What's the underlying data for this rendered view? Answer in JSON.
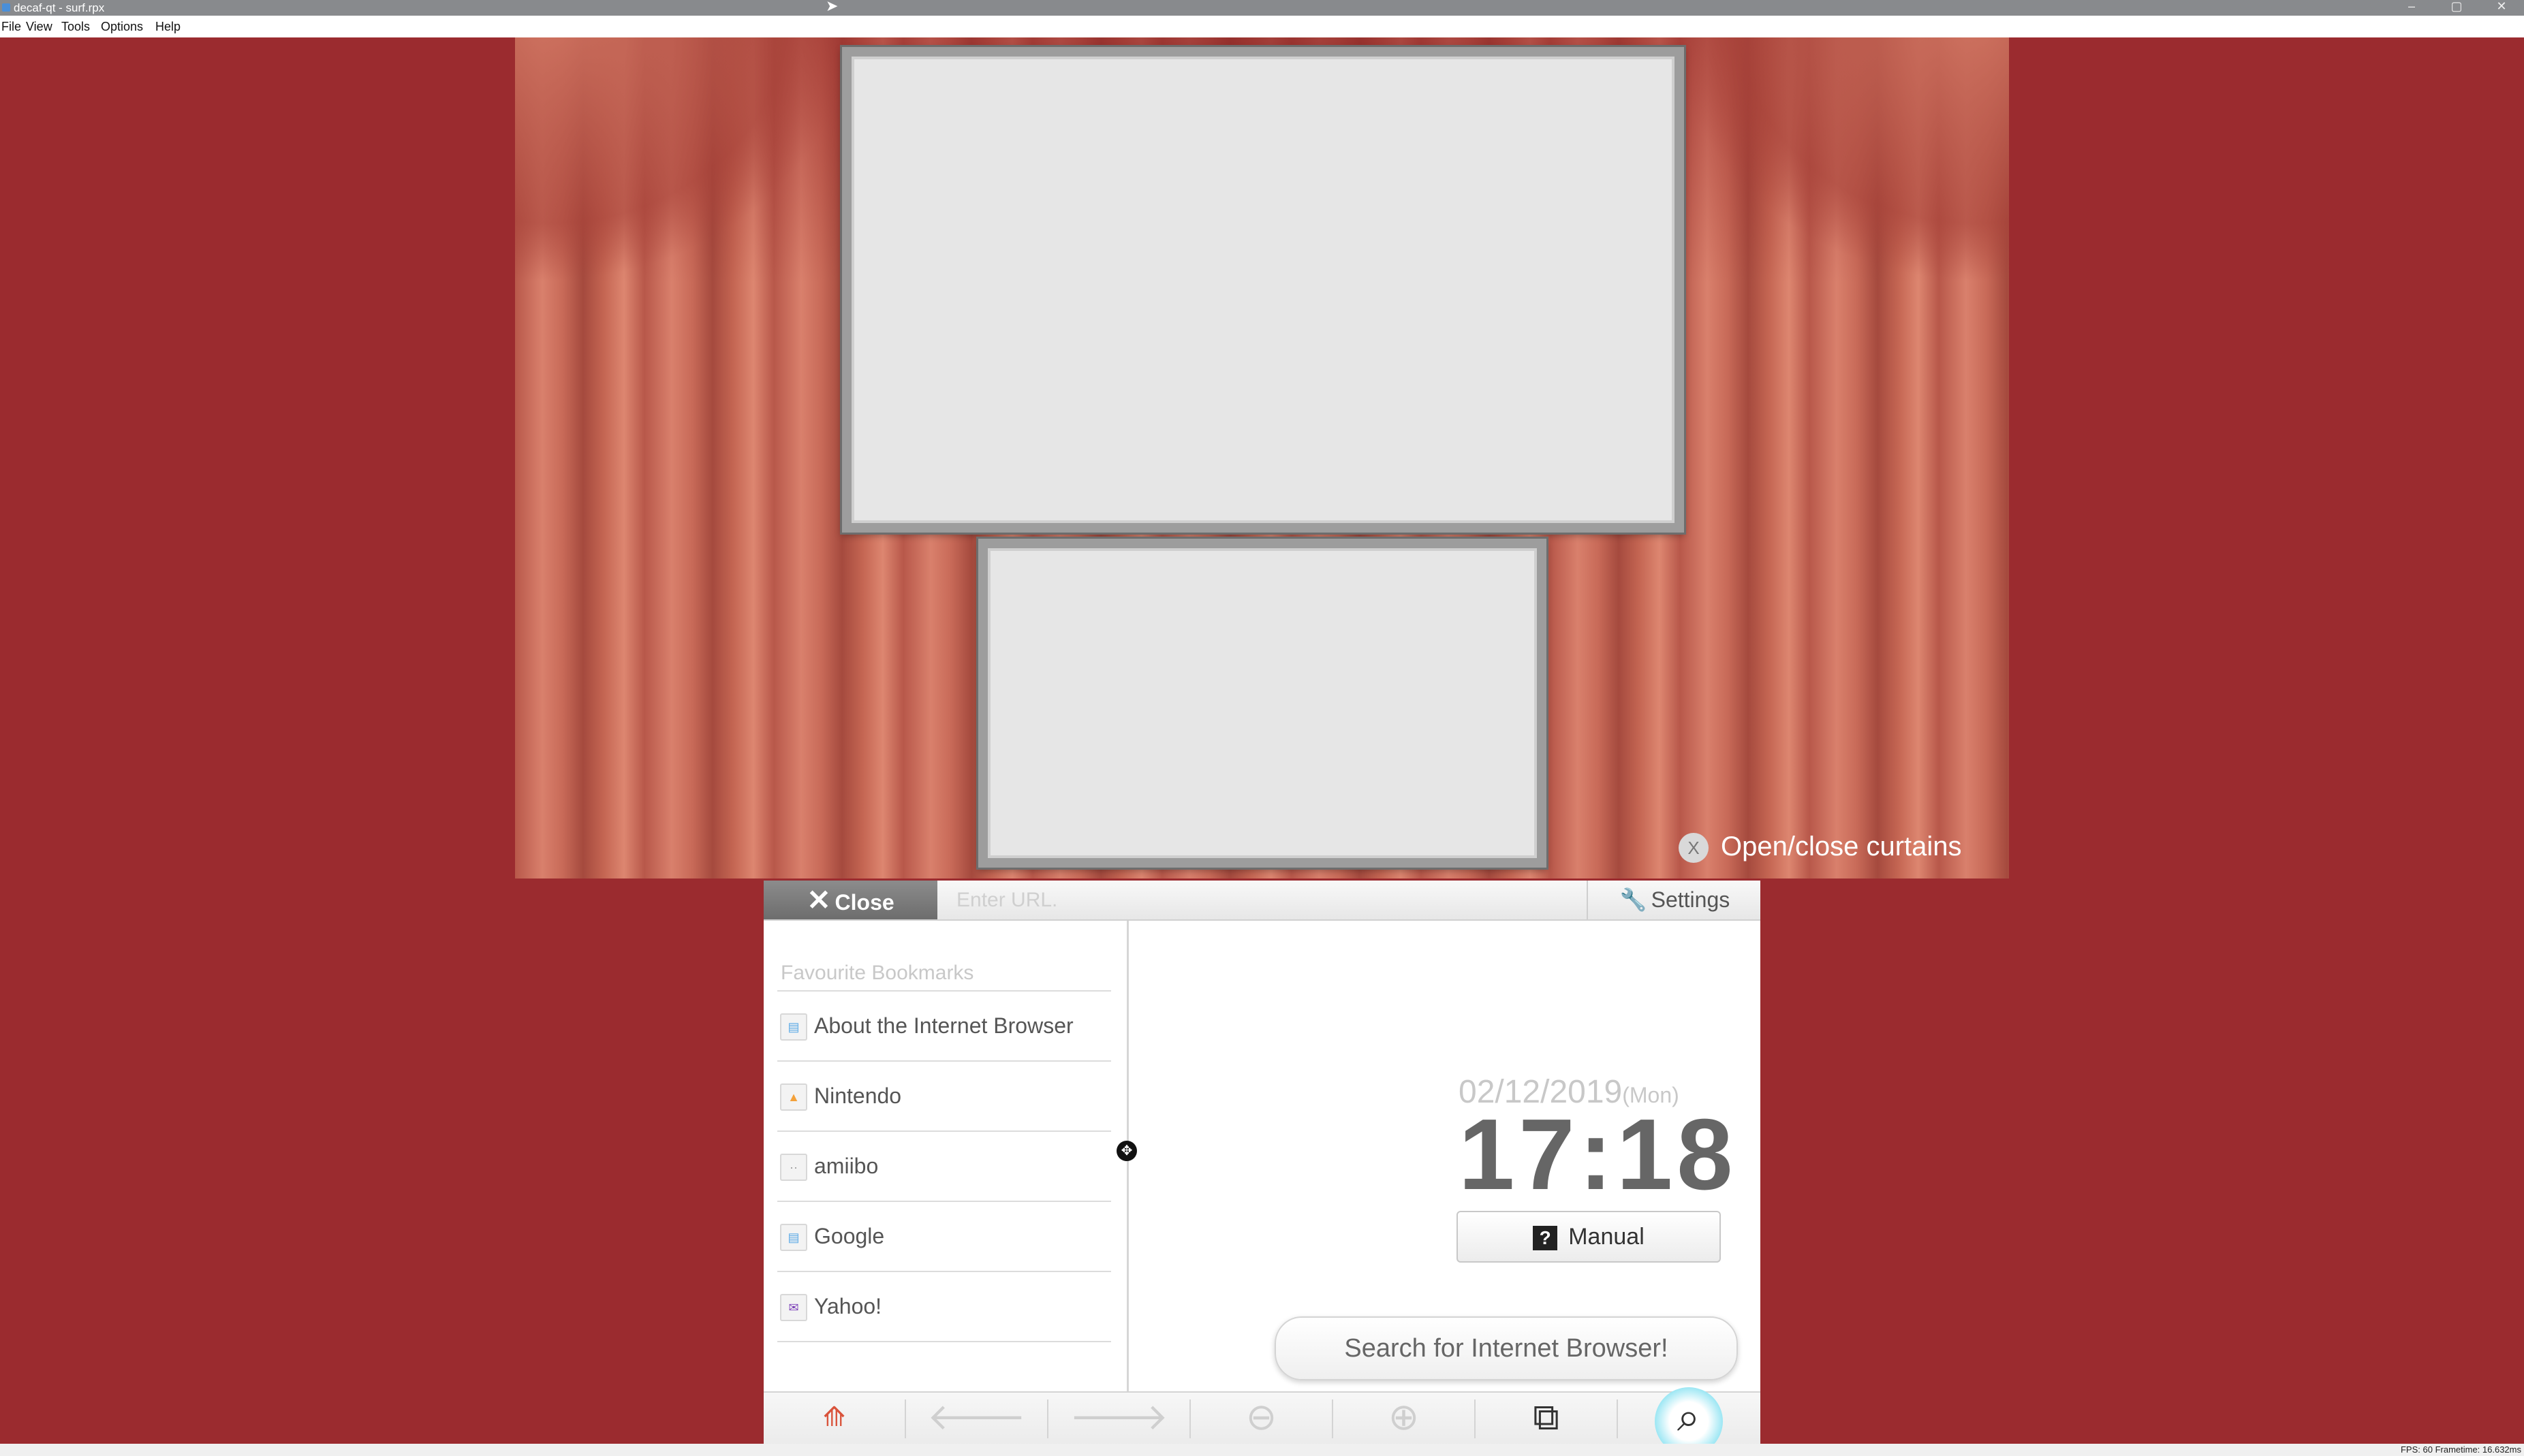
{
  "window": {
    "title": "decaf-qt - surf.rpx",
    "controls": {
      "minimize": "–",
      "maximize": "▢",
      "close": "✕"
    }
  },
  "menu": [
    "File",
    "View",
    "Tools",
    "Options",
    "Help"
  ],
  "stage": {
    "curtain_hint_key": "X",
    "curtain_hint_label": "Open/close curtains"
  },
  "browser": {
    "close_label": "Close",
    "url_placeholder": "Enter URL.",
    "settings_label": "Settings",
    "bookmarks_title": "Favourite Bookmarks",
    "bookmarks": [
      {
        "label": "About the Internet Browser",
        "icon": "browser-icon",
        "glyph": "▤",
        "color": "#5aa9e6"
      },
      {
        "label": "Nintendo",
        "icon": "nintendo-icon",
        "glyph": "▲",
        "color": "#f3a13a"
      },
      {
        "label": "amiibo",
        "icon": "amiibo-icon",
        "glyph": "··",
        "color": "#9a9a9a"
      },
      {
        "label": "Google",
        "icon": "google-icon",
        "glyph": "▤",
        "color": "#5aa9e6"
      },
      {
        "label": "Yahoo!",
        "icon": "yahoo-icon",
        "glyph": "✉",
        "color": "#7b3fb8"
      }
    ],
    "date": "02/12/2019",
    "weekday": "(Mon)",
    "time": "17:18",
    "manual_label": "Manual",
    "search_bubble": "Search for Internet Browser!",
    "toolbar": {
      "back": "🡐",
      "forward": "🡒",
      "zoom_out": "⊖",
      "zoom_in": "⊕",
      "tabs": "⧉",
      "search": "⌕"
    }
  },
  "status": {
    "fps": "FPS: 60 Frametime: 16.632ms"
  }
}
